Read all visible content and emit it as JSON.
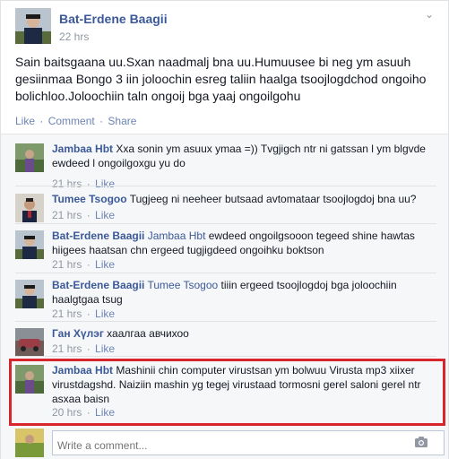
{
  "post": {
    "author": "Bat-Erdene Baagii",
    "timestamp": "22 hrs",
    "text": "Sain baitsgaana uu.Sxan naadmalj bna uu.Humuusee bi neg ym asuuh gesiinmaa Bongo 3 iin joloochin esreg taliin haalga tsoojlogdchod ongoiho bolichloo.Joloochiin taln ongoij bga yaaj ongoilgohu",
    "actions": {
      "like": "Like",
      "comment": "Comment",
      "share": "Share",
      "separator": "·"
    }
  },
  "comments": [
    {
      "author": "Jambaa Hbt",
      "mention": "",
      "text": "Xxa sonin ym asuux ymaa =)) Tvgjigch ntr ni gatssan l ym blgvde ewdeed l ongoilgoxgu yu do",
      "time": "21 hrs",
      "like": "Like"
    },
    {
      "author": "Tumee Tsogoo",
      "mention": "",
      "text": "Tugjeeg ni neeheer butsaad avtomataar tsoojlogdoj bna uu?",
      "time": "21 hrs",
      "like": "Like"
    },
    {
      "author": "Bat-Erdene Baagii",
      "mention": "Jambaa Hbt",
      "text": "ewdeed ongoilgsooon tegeed shine hawtas hiigees haatsan chn ergeed tugjigdeed ongoihku boktson",
      "time": "21 hrs",
      "like": "Like"
    },
    {
      "author": "Bat-Erdene Baagii",
      "mention": "Tumee Tsogoo",
      "text": "tiiin ergeed tsoojlogdoj bga joloochiin haalgtgaa tsug",
      "time": "21 hrs",
      "like": "Like"
    },
    {
      "author": "Ган Хүлэг",
      "mention": "",
      "text": "хаалгаа авчихоо",
      "time": "21 hrs",
      "like": "Like"
    },
    {
      "author": "Jambaa Hbt",
      "mention": "",
      "text": "Mashinii chin computer virustsan ym bolwuu Virusta mp3 xiixer virustdagshd. Naiziin mashin yg tegej virustaad tormosni gerel saloni gerel ntr asxaa baisn",
      "time": "20 hrs",
      "like": "Like"
    }
  ],
  "composer": {
    "placeholder": "Write a comment..."
  },
  "icons": {
    "chevron": "chevron-down-icon",
    "camera": "camera-icon"
  },
  "colors": {
    "link": "#3b5998",
    "highlight": "#d9262c"
  }
}
